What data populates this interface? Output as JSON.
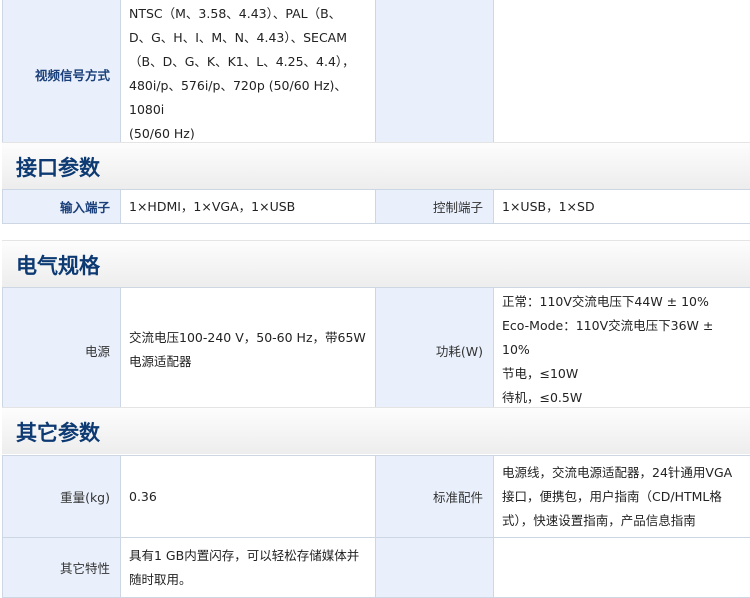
{
  "video": {
    "label": "视频信号方式",
    "lines": [
      "NTSC（M、3.58、4.43）、PAL（B、",
      "D、G、H、I、M、N、4.43）、SECAM",
      "（B、D、G、K、K1、L、4.25、4.4），",
      "480i/p、576i/p、720p (50/60 Hz)、1080i",
      "(50/60 Hz)"
    ]
  },
  "interface": {
    "title": "接口参数",
    "input_label": "输入端子",
    "input_value": "1×HDMI，1×VGA，1×USB",
    "control_label": "控制端子",
    "control_value": "1×USB，1×SD"
  },
  "electrical": {
    "title": "电气规格",
    "power_label": "电源",
    "power_lines": [
      "交流电压100-240 V，50-60 Hz，带65W",
      "电源适配器"
    ],
    "consumption_label": "功耗(W)",
    "consumption_lines": [
      "正常：110V交流电压下44W ± 10%",
      "Eco-Mode：110V交流电压下36W ± 10%",
      "节电，≤10W",
      "待机，≤0.5W"
    ]
  },
  "other": {
    "title": "其它参数",
    "weight_label": "重量(kg)",
    "weight_value": "0.36",
    "accessories_label": "标准配件",
    "accessories_lines": [
      "电源线，交流电源适配器，24针通用VGA",
      "接口，便携包，用户指南（CD/HTML格",
      "式），快速设置指南，产品信息指南"
    ],
    "features_label": "其它特性",
    "features_lines": [
      "具有1 GB内置闪存，可以轻松存储媒体并",
      "随时取用。"
    ]
  }
}
